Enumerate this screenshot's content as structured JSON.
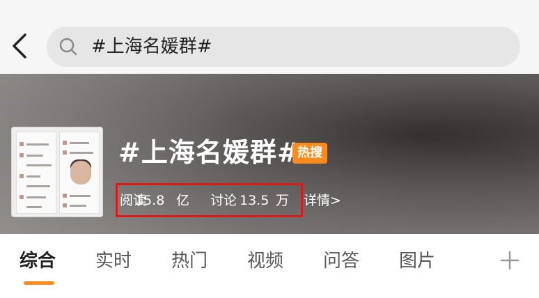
{
  "search": {
    "query": "#上海名媛群#"
  },
  "topic": {
    "title": "#上海名媛群#",
    "hot_badge": "热搜",
    "stats": {
      "read_label": "阅读",
      "read_value": "15.8",
      "read_unit": "亿",
      "discuss_label": "讨论",
      "discuss_value": "13.5",
      "discuss_unit": "万"
    },
    "details_link": "详情>"
  },
  "tabs": [
    {
      "label": "综合",
      "active": true
    },
    {
      "label": "实时",
      "active": false
    },
    {
      "label": "热门",
      "active": false
    },
    {
      "label": "视频",
      "active": false
    },
    {
      "label": "问答",
      "active": false
    },
    {
      "label": "图片",
      "active": false
    }
  ],
  "icons": {
    "back": "chevron-left-icon",
    "search": "search-icon",
    "add_tab": "plus-icon"
  },
  "colors": {
    "accent": "#ff8a1c",
    "highlight_box": "#e01818",
    "search_bg": "#e6e6e6"
  }
}
